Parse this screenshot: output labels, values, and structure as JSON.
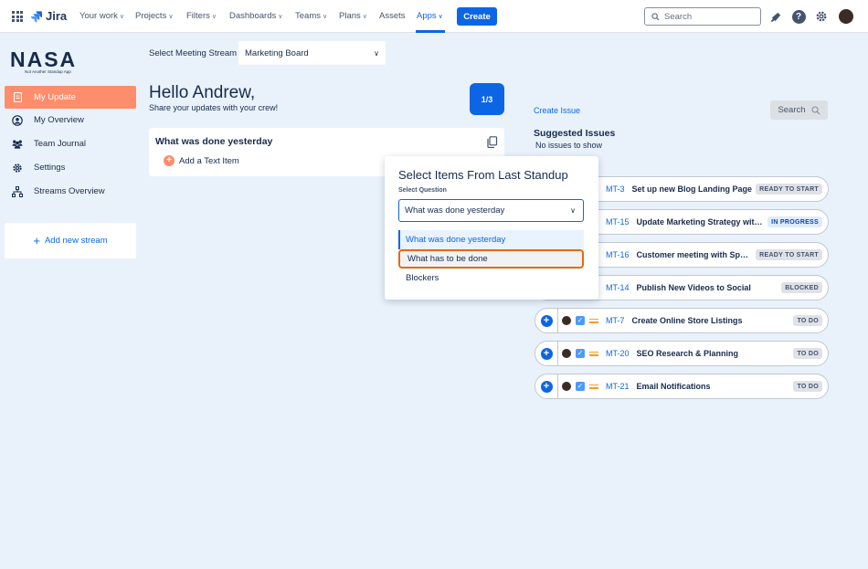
{
  "topnav": {
    "brand": "Jira",
    "items": [
      {
        "label": "Your work",
        "has_chevron": true
      },
      {
        "label": "Projects",
        "has_chevron": true
      },
      {
        "label": "Filters",
        "has_chevron": true
      },
      {
        "label": "Dashboards",
        "has_chevron": true
      },
      {
        "label": "Teams",
        "has_chevron": true
      },
      {
        "label": "Plans",
        "has_chevron": true
      },
      {
        "label": "Assets",
        "has_chevron": false
      },
      {
        "label": "Apps",
        "has_chevron": true
      }
    ],
    "create_label": "Create",
    "search_placeholder": "Search"
  },
  "sidebar": {
    "logo_text": "NASA",
    "logo_subtitle": "Not Another Standup App",
    "items": [
      {
        "label": "My Update",
        "icon": "document-icon",
        "active": true
      },
      {
        "label": "My Overview",
        "icon": "user-circle-icon",
        "active": false
      },
      {
        "label": "Team Journal",
        "icon": "team-icon",
        "active": false
      },
      {
        "label": "Settings",
        "icon": "gear-icon",
        "active": false
      },
      {
        "label": "Streams Overview",
        "icon": "hierarchy-icon",
        "active": false
      }
    ],
    "add_stream_label": "Add new stream"
  },
  "main": {
    "stream_label": "Select Meeting Stream",
    "stream_value": "Marketing Board",
    "greeting": "Hello Andrew,",
    "subtitle": "Share your updates with your crew!",
    "page_indicator": "1/3",
    "card_title": "What was done yesterday",
    "add_text_label": "Add a Text Item"
  },
  "popup": {
    "title": "Select Items From Last Standup",
    "question_label": "Select Question",
    "selected_value": "What was done yesterday",
    "options": [
      "What was done yesterday",
      "What has to be done",
      "Blockers"
    ]
  },
  "right": {
    "create_issue_label": "Create Issue",
    "search_label": "Search",
    "suggested_title": "Suggested Issues",
    "no_issues_text": "No issues to show",
    "issues": [
      {
        "key": "MT-3",
        "title": "Set up new Blog Landing Page",
        "status": "READY TO START",
        "status_color": "grey"
      },
      {
        "key": "MT-15",
        "title": "Update Marketing Strategy wit…",
        "status": "IN PROGRESS",
        "status_color": "blue"
      },
      {
        "key": "MT-16",
        "title": "Customer meeting with Sp…",
        "status": "READY TO START",
        "status_color": "grey"
      },
      {
        "key": "MT-14",
        "title": "Publish New Videos to Social",
        "status": "BLOCKED",
        "status_color": "grey"
      },
      {
        "key": "MT-7",
        "title": "Create Online Store Listings",
        "status": "TO DO",
        "status_color": "grey"
      },
      {
        "key": "MT-20",
        "title": "SEO Research & Planning",
        "status": "TO DO",
        "status_color": "grey"
      },
      {
        "key": "MT-21",
        "title": "Email Notifications",
        "status": "TO DO",
        "status_color": "grey"
      }
    ]
  },
  "colors": {
    "accent": "#0c66e4",
    "active_sidebar": "#fe8d6c",
    "background": "#e9f2fb",
    "highlight_border": "#e56910"
  }
}
